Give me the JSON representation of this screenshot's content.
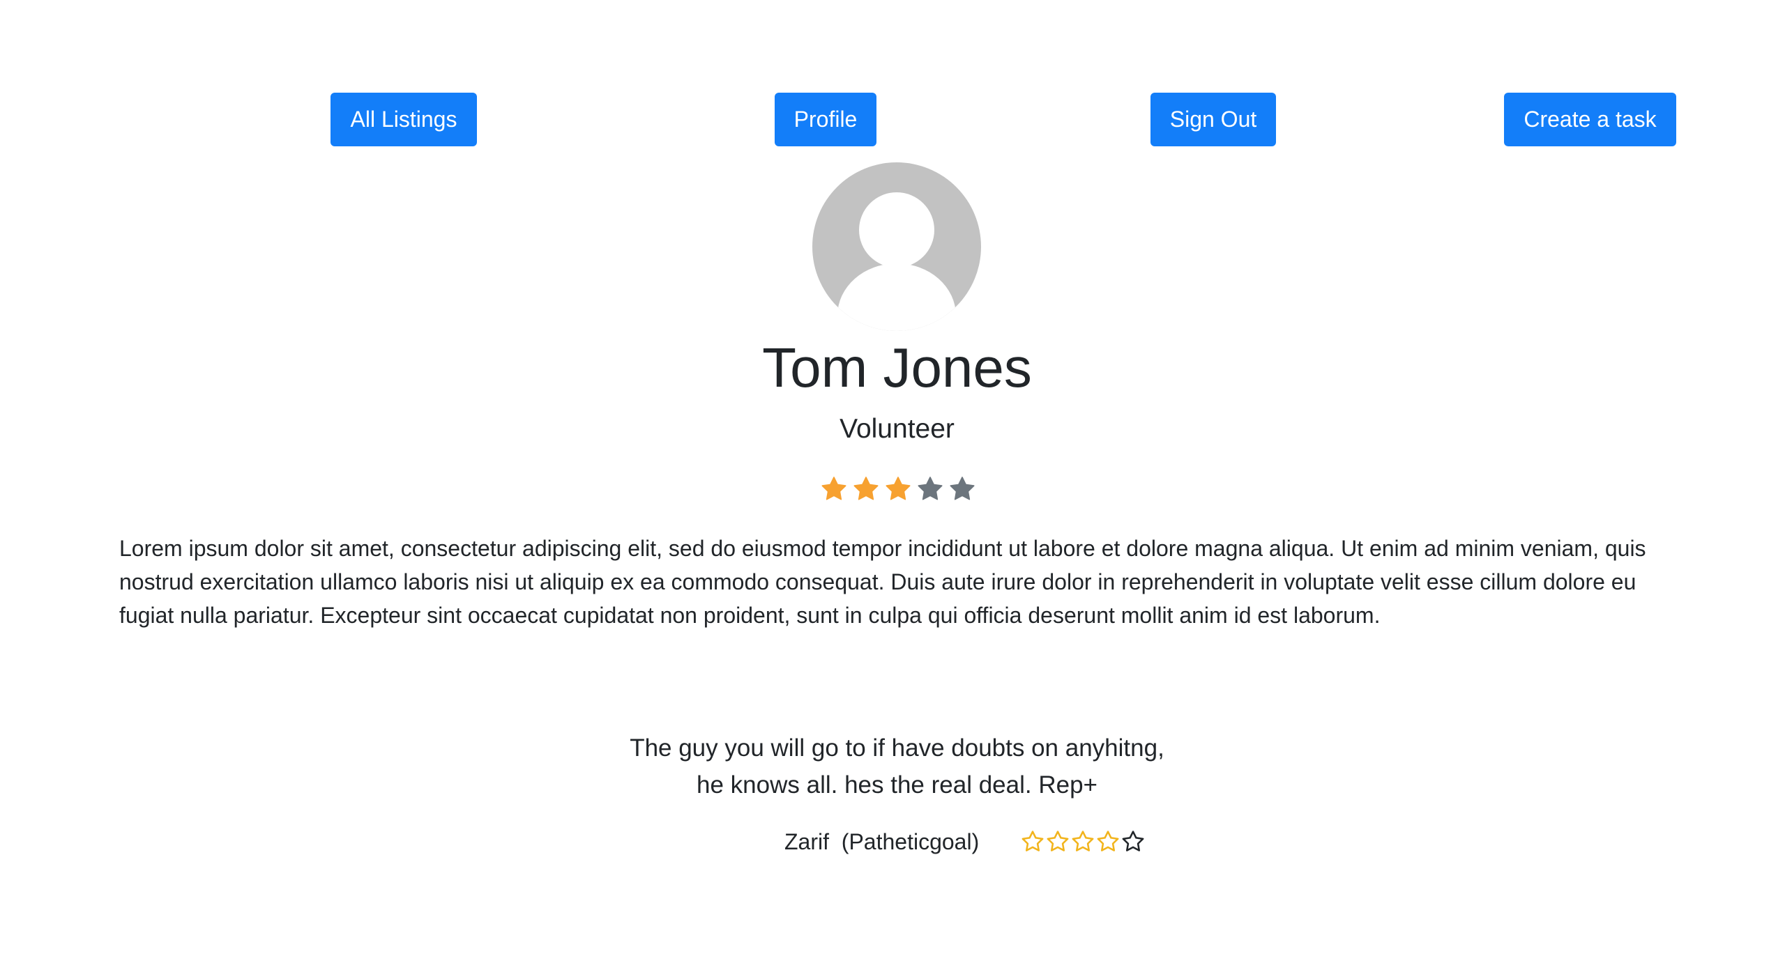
{
  "nav": {
    "all_listings": "All Listings",
    "profile": "Profile",
    "sign_out": "Sign Out",
    "create_task": "Create a task"
  },
  "profile": {
    "avatar_icon": "user-avatar-placeholder-icon",
    "name": "Tom Jones",
    "role": "Volunteer",
    "rating": 3,
    "rating_max": 5,
    "star_filled_color": "#f7a130",
    "star_empty_color": "#6c757d",
    "bio": "Lorem ipsum dolor sit amet, consectetur adipiscing elit, sed do eiusmod tempor incididunt ut labore et dolore magna aliqua. Ut enim ad minim veniam, quis nostrud exercitation ullamco laboris nisi ut aliquip ex ea commodo consequat. Duis aute irure dolor in reprehenderit in voluptate velit esse cillum dolore eu fugiat nulla pariatur. Excepteur sint occaecat cupidatat non proident, sunt in culpa qui officia deserunt mollit anim id est laborum."
  },
  "review": {
    "line1": "The guy you will go to if have doubts on anyhitng,",
    "line2": "he knows all. hes the real deal. Rep+",
    "reviewer": "Zarif  (Patheticgoal)",
    "rating": 4,
    "rating_max": 5,
    "star_gold_color": "#f2b41c",
    "star_dark_color": "#212529"
  },
  "colors": {
    "button_bg": "#137ef9",
    "button_text": "#ffffff",
    "text": "#212529"
  }
}
